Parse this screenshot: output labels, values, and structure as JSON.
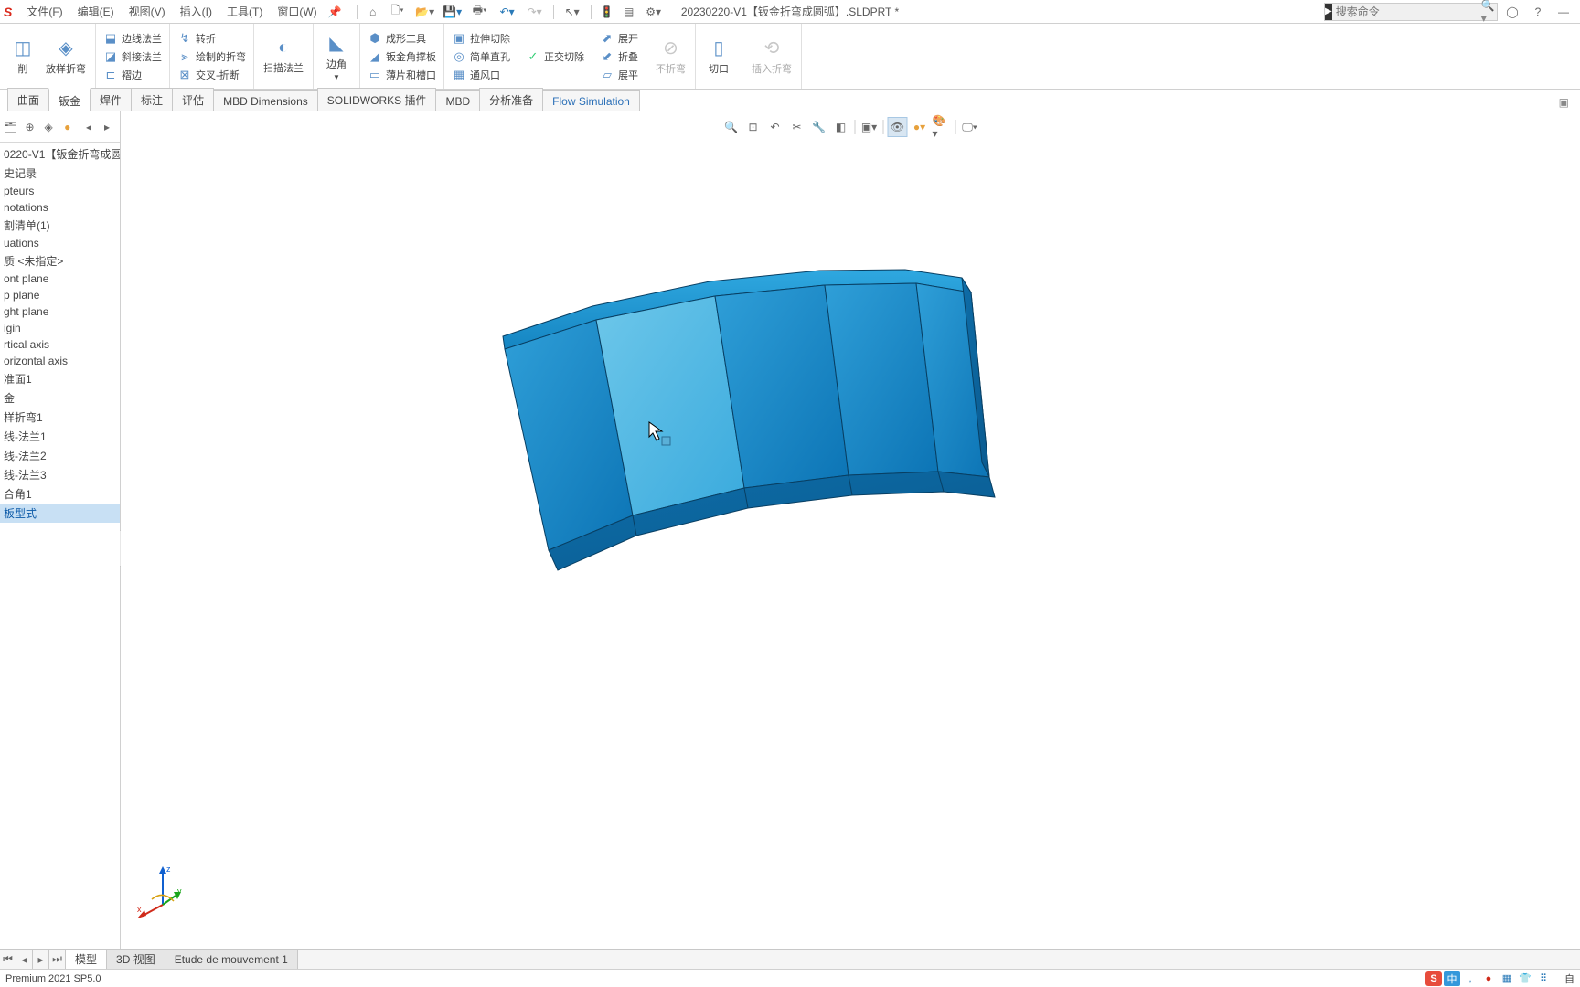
{
  "menubar": {
    "logo": "S",
    "menus": [
      "文件(F)",
      "编辑(E)",
      "视图(V)",
      "插入(I)",
      "工具(T)",
      "窗口(W)"
    ],
    "doc_title": "20230220-V1【钣金折弯成圆弧】.SLDPRT *",
    "search_placeholder": "搜索命令"
  },
  "ribbon": {
    "big_buttons_left": [
      "削",
      "放样折弯"
    ],
    "flange_col": [
      "边线法兰",
      "斜接法兰",
      "褶边"
    ],
    "jog_col": [
      "转折",
      "绘制的折弯",
      "交叉-折断"
    ],
    "sweep_big": "扫描法兰",
    "corner_big": "边角",
    "form_col": [
      "成形工具",
      "钣金角撑板",
      "薄片和槽口"
    ],
    "cut_col": [
      "拉伸切除",
      "简单直孔",
      "通风口"
    ],
    "normal_cut": "正交切除",
    "unfold_col": [
      "展开",
      "折叠",
      "展平"
    ],
    "nobend": "不折弯",
    "cut_big": "切口",
    "insert_bend": "插入折弯"
  },
  "tabs": [
    "曲面",
    "钣金",
    "焊件",
    "标注",
    "评估",
    "MBD Dimensions",
    "SOLIDWORKS 插件",
    "MBD",
    "分析准备",
    "Flow Simulation"
  ],
  "active_tab_index": 1,
  "tree": {
    "items": [
      "0220-V1【钣金折弯成圆",
      "史记录",
      "pteurs",
      "notations",
      "割清单(1)",
      "uations",
      "质 <未指定>",
      "ont plane",
      "p plane",
      "ght plane",
      "igin",
      "rtical axis",
      "orizontal axis",
      "准面1",
      "金",
      "样折弯1",
      "线-法兰1",
      "线-法兰2",
      "线-法兰3",
      "合角1",
      "板型式"
    ],
    "selected_index": 20
  },
  "bottom_tabs": [
    "模型",
    "3D 视图",
    "Etude de mouvement 1"
  ],
  "bottom_active": 0,
  "status_left": "Premium 2021 SP5.0",
  "status_right": [
    "中",
    ",",
    "●",
    "▦",
    "👕",
    "⠿"
  ],
  "ime_main": "S",
  "status_edit": "自",
  "axes": {
    "x": "x",
    "y": "y",
    "z": "z"
  }
}
